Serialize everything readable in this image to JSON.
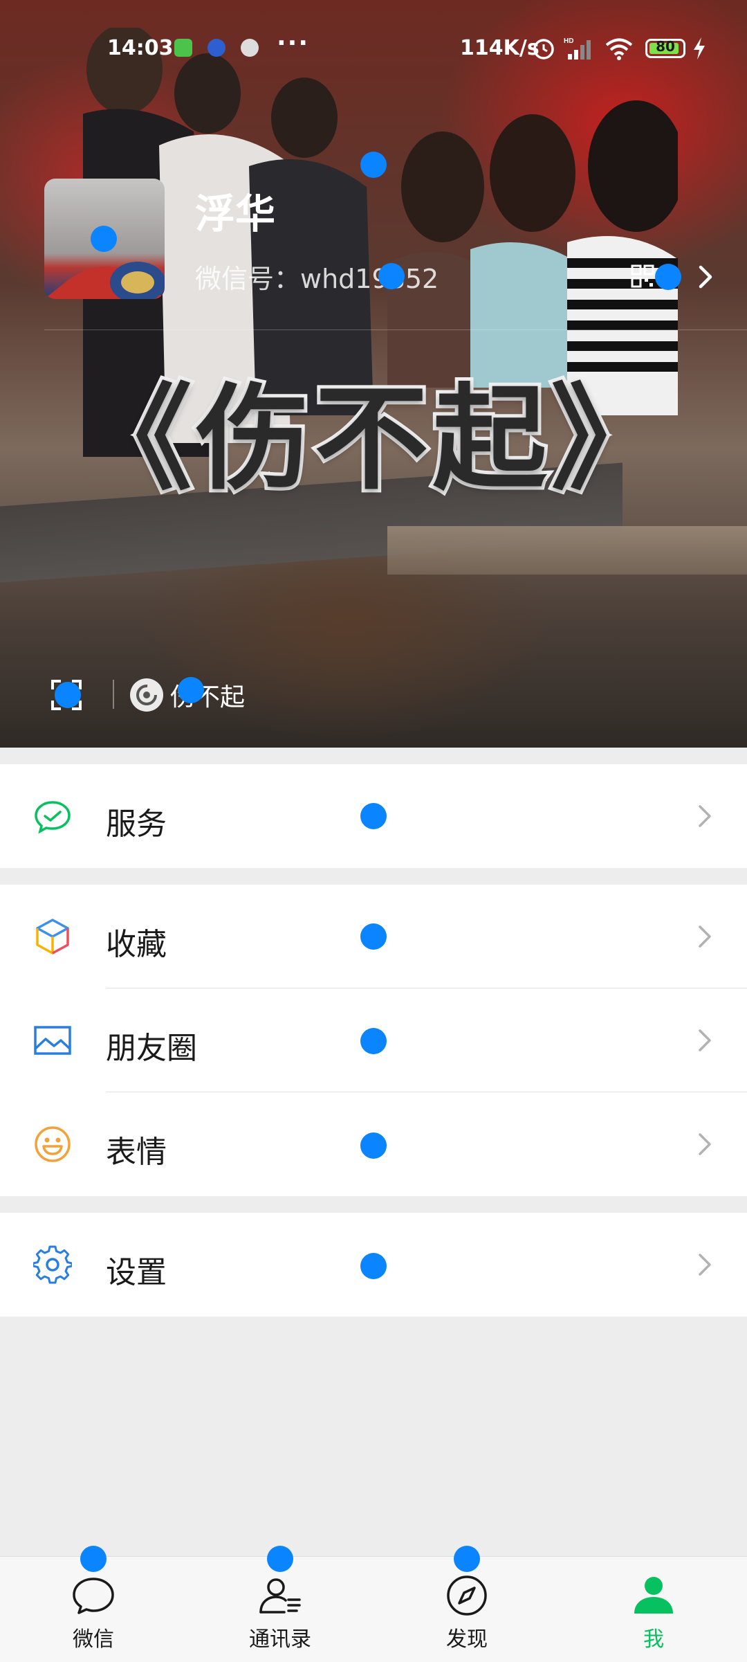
{
  "status_bar": {
    "time": "14:03",
    "more": "···",
    "network_speed": "114K/s",
    "battery_level": "80"
  },
  "profile": {
    "nickname": "浮华",
    "wechat_id": "微信号：whd19852",
    "status_text": "伤不起"
  },
  "cover": {
    "overlay_text": "《伤不起》"
  },
  "menu": {
    "services": "服务",
    "favorites": "收藏",
    "moments": "朋友圈",
    "stickers": "表情",
    "settings": "设置"
  },
  "tabs": {
    "chats": "微信",
    "contacts": "通讯录",
    "discover": "发现",
    "me": "我"
  },
  "colors": {
    "accent_green": "#07c160",
    "marker_blue": "#0a84ff",
    "background": "#ededed"
  }
}
